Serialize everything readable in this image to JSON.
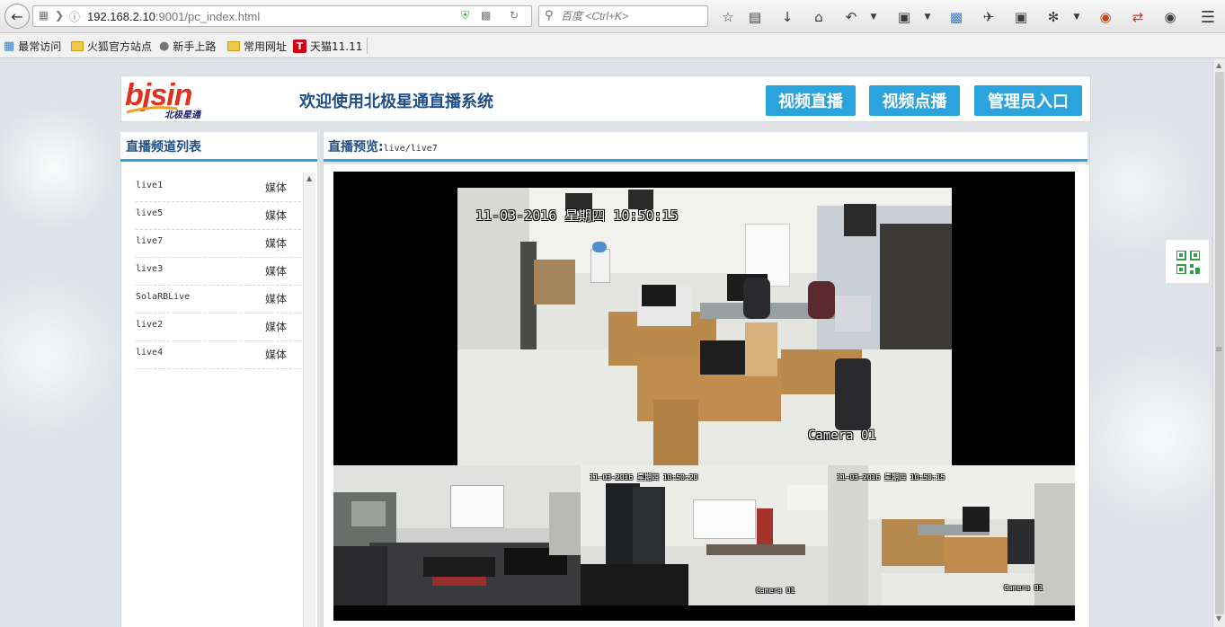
{
  "browser": {
    "url_host": "192.168.2.10",
    "url_rest": ":9001/pc_index.html",
    "search_placeholder": "百度 <Ctrl+K>"
  },
  "bookmarks": [
    {
      "label": "最常访问"
    },
    {
      "label": "火狐官方站点"
    },
    {
      "label": "新手上路"
    },
    {
      "label": "常用网址"
    },
    {
      "label": "天猫11.11",
      "badge": "T"
    }
  ],
  "header": {
    "logo_text": "bjsin",
    "logo_sub": "北极星通",
    "title": "欢迎使用北极星通直播系统",
    "nav": [
      "视频直播",
      "视频点播",
      "管理员入口"
    ]
  },
  "channels": {
    "title": "直播频道列表",
    "items": [
      {
        "name": "live1",
        "type": "媒体"
      },
      {
        "name": "live5",
        "type": "媒体"
      },
      {
        "name": "live7",
        "type": "媒体"
      },
      {
        "name": "live3",
        "type": "媒体"
      },
      {
        "name": "SolaRBLive",
        "type": "媒体"
      },
      {
        "name": "live2",
        "type": "媒体"
      },
      {
        "name": "live4",
        "type": "媒体"
      }
    ]
  },
  "preview": {
    "title": "直播预览:",
    "path": "live/live7"
  },
  "video": {
    "main_timestamp": "11-03-2016 星期四 10:50:15",
    "main_camera": "Camera 01",
    "thumb2_timestamp": "11-03-2016 星期四 10:50:20",
    "thumb3_timestamp": "11-03-2016 星期四 10:50:15",
    "thumb_camera": "Camera 01"
  },
  "colors": {
    "accent": "#2ba3dc",
    "title_blue": "#1f4f86",
    "logo_red": "#e0301e"
  }
}
